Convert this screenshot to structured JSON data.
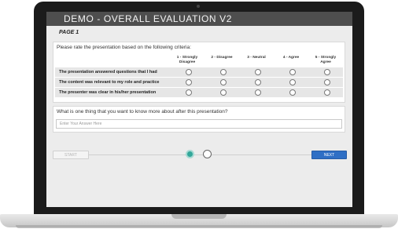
{
  "survey": {
    "title": "DEMO - OVERALL EVALUATION V2",
    "page_label": "PAGE 1",
    "rating": {
      "prompt": "Please rate the presentation based on the following criteria:",
      "scale": [
        "1 - Strongly Disagree",
        "2 - Disagree",
        "3 - Neutral",
        "4 - Agree",
        "5 - Strongly Agree"
      ],
      "rows": [
        "The presentation answered questions that I had",
        "The content was relevant to my role and practice",
        "The presenter was clear in his/her presentation"
      ]
    },
    "open_question": {
      "prompt": "What is one thing that you want to know more about after this presentation?",
      "placeholder": "Enter Your Answer Here"
    },
    "nav": {
      "start_label": "START",
      "next_label": "NEXT"
    }
  },
  "colors": {
    "title_bar": "#4e4e4e",
    "next_button": "#2f6fc5",
    "active_step": "#33a79a"
  }
}
